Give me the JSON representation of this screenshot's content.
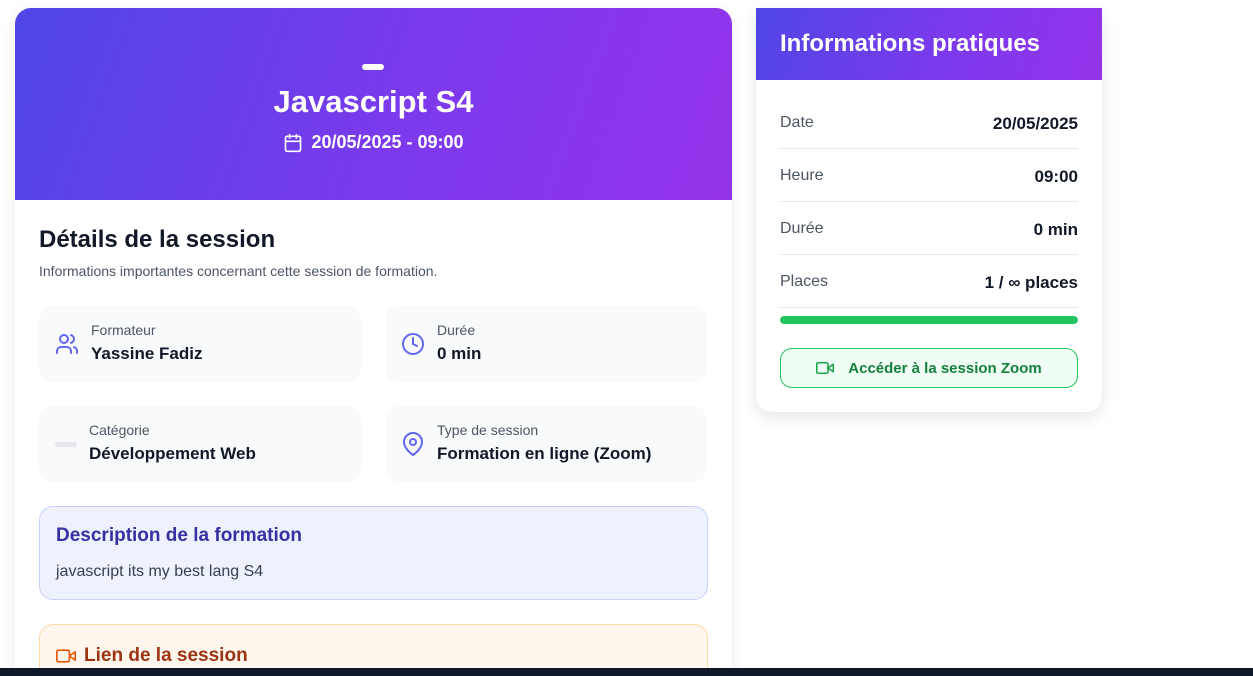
{
  "hero": {
    "title": "Javascript S4",
    "datetime": "20/05/2025 - 09:00"
  },
  "details": {
    "title": "Détails de la session",
    "subtitle": "Informations importantes concernant cette session de formation."
  },
  "info_cards": {
    "trainer": {
      "label": "Formateur",
      "value": "Yassine Fadiz",
      "icon": "users-icon"
    },
    "duration": {
      "label": "Durée",
      "value": "0 min",
      "icon": "clock-icon"
    },
    "category": {
      "label": "Catégorie",
      "value": "Développement Web",
      "icon": "placeholder-bar"
    },
    "session_type": {
      "label": "Type de session",
      "value": "Formation en ligne (Zoom)",
      "icon": "map-pin-icon"
    }
  },
  "description": {
    "title": "Description de la formation",
    "text": "javascript its my best lang S4"
  },
  "session_link": {
    "title": "Lien de la session",
    "icon": "video-icon"
  },
  "practical_info": {
    "title": "Informations pratiques",
    "rows": [
      {
        "label": "Date",
        "value": "20/05/2025"
      },
      {
        "label": "Heure",
        "value": "09:00"
      },
      {
        "label": "Durée",
        "value": "0 min"
      },
      {
        "label": "Places",
        "value": "1 / ∞ places"
      }
    ],
    "capacity_fill": 1.0,
    "zoom_button_label": "Accéder à la session Zoom"
  },
  "colors": {
    "gradient_start": "#4f46e5",
    "gradient_end": "#9333ea",
    "success": "#22c55e",
    "accent_indigo": "#3730a3",
    "accent_orange": "#9a3412"
  }
}
